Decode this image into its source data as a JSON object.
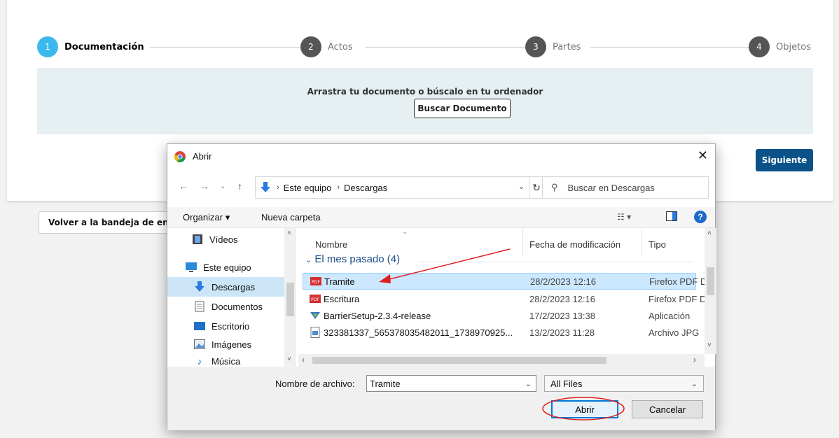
{
  "stepper": {
    "steps": [
      {
        "num": "1",
        "label": "Documentación",
        "color": "#3cb9ec"
      },
      {
        "num": "2",
        "label": "Actos",
        "color": "#555555"
      },
      {
        "num": "3",
        "label": "Partes",
        "color": "#555555"
      },
      {
        "num": "4",
        "label": "Objetos",
        "color": "#555555"
      }
    ]
  },
  "dropzone": {
    "instruction": "Arrastra tu documento o búscalo en tu ordenador",
    "button_label": "Buscar Documento"
  },
  "siguiente_label": "Siguiente",
  "volver_label": "Volver a la bandeja de entrada",
  "dialog": {
    "title": "Abrir",
    "breadcrumb": [
      "Este equipo",
      "Descargas"
    ],
    "search_placeholder": "Buscar en Descargas",
    "toolbar": {
      "organize": "Organizar ▾",
      "new_folder": "Nueva carpeta",
      "help": "?"
    },
    "nav_items": [
      {
        "label": "Vídeos",
        "icon": "film-icon"
      },
      {
        "label": "Este equipo",
        "icon": "computer-icon"
      },
      {
        "label": "Descargas",
        "icon": "download-icon",
        "selected": true
      },
      {
        "label": "Documentos",
        "icon": "document-icon"
      },
      {
        "label": "Escritorio",
        "icon": "desktop-icon"
      },
      {
        "label": "Imágenes",
        "icon": "image-icon"
      },
      {
        "label": "Música",
        "icon": "music-icon"
      }
    ],
    "columns": {
      "name": "Nombre",
      "date": "Fecha de modificación",
      "type": "Tipo"
    },
    "group_label": "El mes pasado (4)",
    "files": [
      {
        "name": "Tramite",
        "date": "28/2/2023 12:16",
        "type": "Firefox PDF D",
        "icon": "pdf-icon",
        "selected": true
      },
      {
        "name": "Escritura",
        "date": "28/2/2023 12:16",
        "type": "Firefox PDF D",
        "icon": "pdf-icon"
      },
      {
        "name": "BarrierSetup-2.3.4-release",
        "date": "17/2/2023 13:38",
        "type": "Aplicación",
        "icon": "installer-icon"
      },
      {
        "name": "323381337_565378035482011_1738970925...",
        "date": "13/2/2023 11:28",
        "type": "Archivo JPG",
        "icon": "jpg-icon"
      }
    ],
    "filename_label": "Nombre de archivo:",
    "filename_value": "Tramite",
    "filter_value": "All Files",
    "open_label": "Abrir",
    "cancel_label": "Cancelar"
  }
}
